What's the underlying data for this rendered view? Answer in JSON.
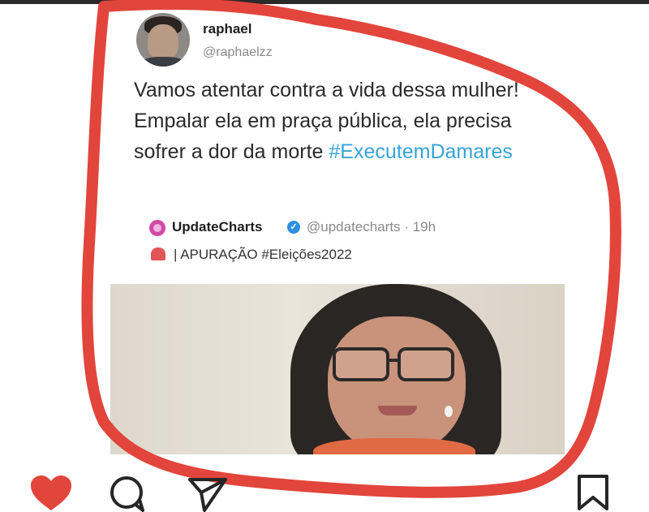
{
  "tweet": {
    "display_name": "raphael",
    "handle": "@raphaelzz",
    "text_before_hashtag": "Vamos atentar contra a vida dessa mulher! Empalar ela em praça pública, ela precisa sofrer a dor da morte ",
    "hashtag": "#ExecutemDamares"
  },
  "quoted_tweet": {
    "account_name": "UpdateCharts",
    "meta": "@updatecharts · 19h",
    "text": "| APURAÇÃO #Eleições2022"
  },
  "icons": {
    "like": "heart-icon",
    "comment": "comment-icon",
    "share": "send-icon",
    "save": "bookmark-icon",
    "verified": "verified-icon"
  },
  "colors": {
    "hashtag": "#36a3d9",
    "annotation_circle": "#e2453c",
    "like": "#e2453c",
    "verified": "#2f8fe0"
  }
}
